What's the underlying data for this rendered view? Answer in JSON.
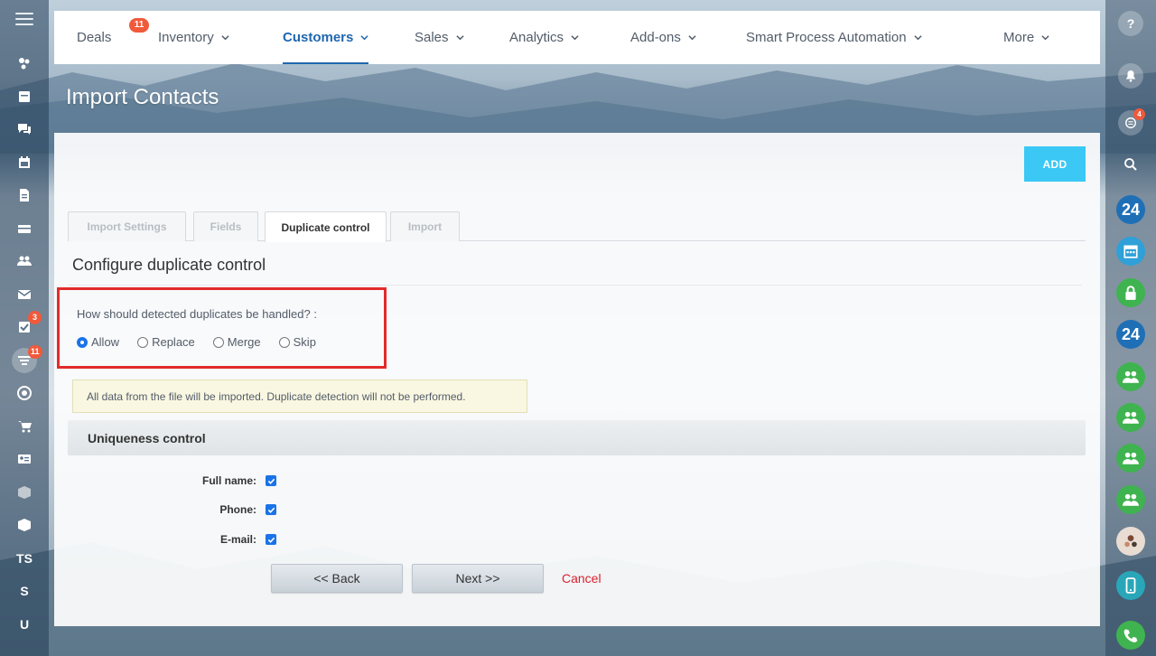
{
  "nav": {
    "items": [
      {
        "label": "Deals",
        "badge": "11"
      },
      {
        "label": "Inventory"
      },
      {
        "label": "Customers"
      },
      {
        "label": "Sales"
      },
      {
        "label": "Analytics"
      },
      {
        "label": "Add-ons"
      },
      {
        "label": "Smart Process Automation"
      },
      {
        "label": "More"
      }
    ]
  },
  "left_sidebar": {
    "badges": {
      "tasks": "3",
      "crm": "11"
    },
    "text_items": [
      "TS",
      "S",
      "U"
    ]
  },
  "right_sidebar": {
    "chat_badge": "4",
    "bitrix_label": "24"
  },
  "page": {
    "title": "Import Contacts",
    "add_label": "ADD"
  },
  "tabs": [
    "Import Settings",
    "Fields",
    "Duplicate control",
    "Import"
  ],
  "section_title": "Configure duplicate control",
  "question": "How should detected duplicates be handled? :",
  "options": [
    "Allow",
    "Replace",
    "Merge",
    "Skip"
  ],
  "selected_option": "Allow",
  "info_text": "All data from the file will be imported. Duplicate detection will not be performed.",
  "uniqueness": {
    "title": "Uniqueness control",
    "fields": [
      {
        "label": "Full name:",
        "checked": true
      },
      {
        "label": "Phone:",
        "checked": true
      },
      {
        "label": "E-mail:",
        "checked": true
      }
    ]
  },
  "buttons": {
    "back": "<< Back",
    "next": "Next >>",
    "cancel": "Cancel"
  },
  "colors": {
    "accent": "#2067b0",
    "add_button": "#3bc8f5",
    "highlight_border": "#e32b2b",
    "cancel": "#d9222e",
    "badge": "#f05a3b"
  }
}
